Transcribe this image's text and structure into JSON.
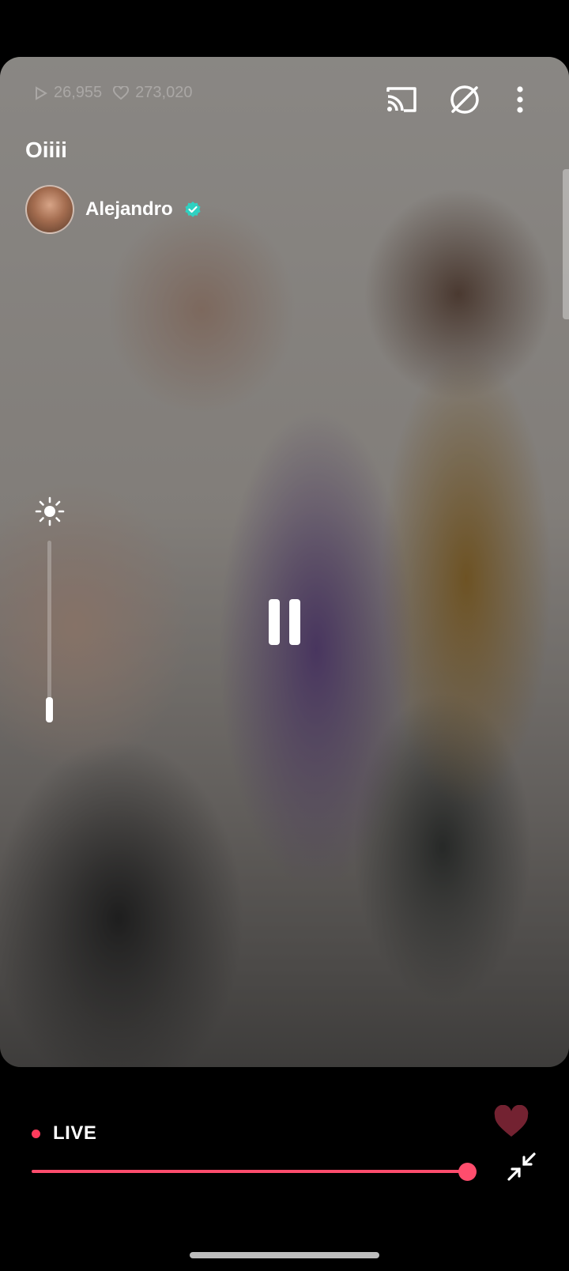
{
  "stats": {
    "views": "26,955",
    "likes": "273,020"
  },
  "stream": {
    "title": "Oiiii",
    "creator_name": "Alejandro"
  },
  "player": {
    "live_label": "LIVE",
    "progress_fraction": 1.0
  },
  "colors": {
    "accent": "#ff4d6d",
    "live_dot": "#ff3b5c",
    "verified": "#2fd1c1"
  },
  "icons": [
    "cast-icon",
    "hide-overlay-icon",
    "more-options-icon",
    "verified-badge-icon",
    "brightness-icon",
    "pause-icon",
    "heart-icon",
    "minimize-icon"
  ]
}
